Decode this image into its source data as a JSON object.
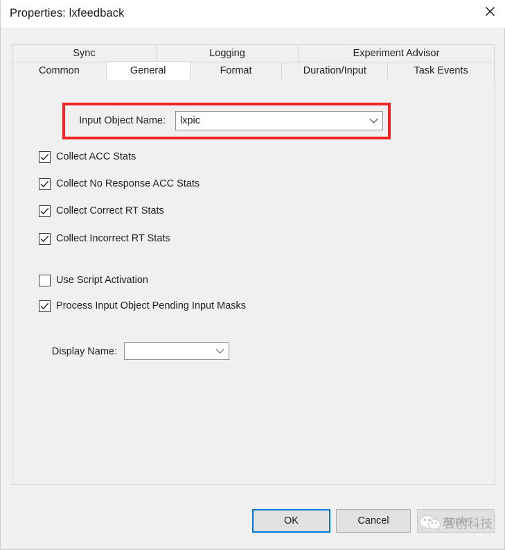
{
  "window": {
    "title": "Properties: lxfeedback",
    "close_icon": "close-icon"
  },
  "tabs": {
    "row1": [
      {
        "label": "Sync",
        "active": false
      },
      {
        "label": "Logging",
        "active": false
      },
      {
        "label": "Experiment Advisor",
        "active": false
      }
    ],
    "row2": [
      {
        "label": "Common",
        "active": false
      },
      {
        "label": "General",
        "active": true
      },
      {
        "label": "Format",
        "active": false
      },
      {
        "label": "Duration/Input",
        "active": false
      },
      {
        "label": "Task Events",
        "active": false
      }
    ]
  },
  "general": {
    "input_object": {
      "label": "Input Object Name:",
      "value": "lxpic",
      "placeholder": "",
      "dropdown_icon": "chevron-down-icon",
      "highlight_color": "#ef2424"
    },
    "checkboxes": [
      {
        "label": "Collect ACC Stats",
        "checked": true
      },
      {
        "label": "Collect No Response ACC Stats",
        "checked": true
      },
      {
        "label": "Collect Correct RT Stats",
        "checked": true
      },
      {
        "label": "Collect Incorrect RT Stats",
        "checked": true
      },
      {
        "label": "Use Script Activation",
        "checked": false
      },
      {
        "label": "Process Input Object Pending Input Masks",
        "checked": true
      }
    ],
    "display_name": {
      "label": "Display Name:",
      "value": "",
      "placeholder": "",
      "dropdown_icon": "chevron-down-icon"
    }
  },
  "footer": {
    "ok_label": "OK",
    "cancel_label": "Cancel",
    "apply_label": "Apply"
  },
  "watermark": {
    "logo_icon": "wechat-icon",
    "text": "茗创科技"
  }
}
